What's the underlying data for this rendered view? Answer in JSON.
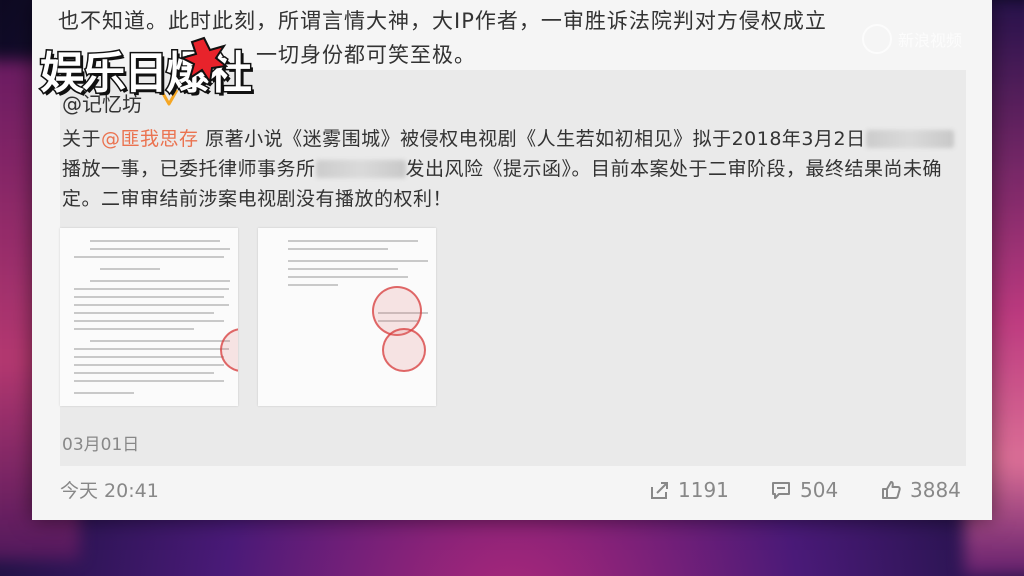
{
  "post": {
    "intro_line1": "也不知道。此时此刻，所谓言情大神，大IP作者，一审胜诉法院判对方侵权成立",
    "intro_line2": "一切身份都可笑至极。"
  },
  "quoted": {
    "author": "@记忆坊",
    "text_prefix": "关于",
    "mention": "@匪我思存",
    "text_1": " 原著小说《迷雾围城》被侵权电视剧《人生若如初相见》拟于2018年3月2日",
    "text_2": "播放一事，已委托律师事务所",
    "text_3": "发出风险《提示函》。目前本案处于二审阶段，最终结果尚未确定。二审审结前涉案电视剧没有播放的权利！",
    "date": "03月01日"
  },
  "footer": {
    "time": "今天 20:41",
    "shares": "1191",
    "comments": "504",
    "likes": "3884"
  },
  "overlay": {
    "logo_text": "娱乐日爆社",
    "watermark": "新浪视频"
  },
  "colors": {
    "mention": "#eb7350",
    "card_bg": "#f5f5f5",
    "quote_bg": "#eaeaea"
  },
  "icons": [
    "verified-badge-icon",
    "share-icon",
    "comment-icon",
    "like-icon"
  ]
}
